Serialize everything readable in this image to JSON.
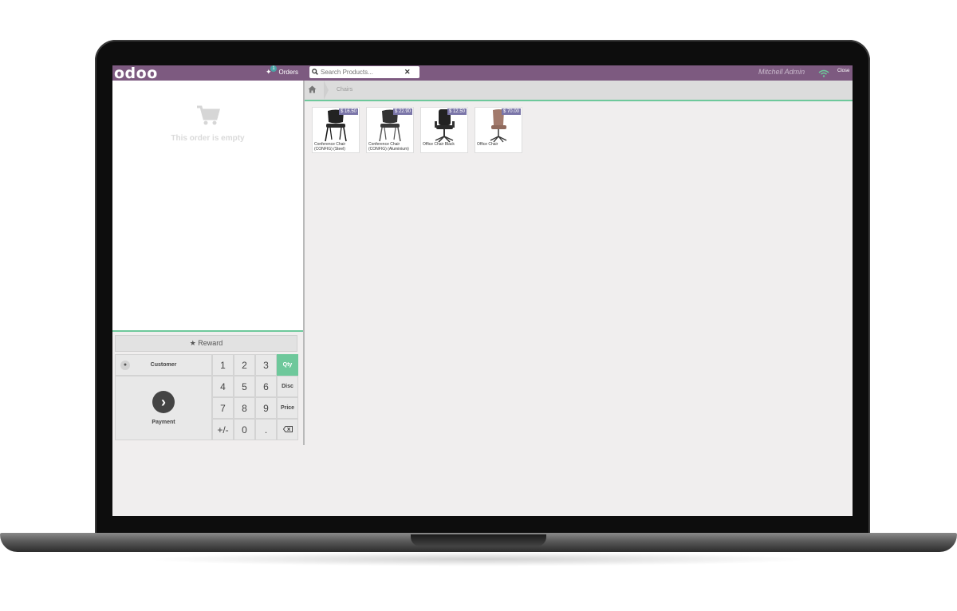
{
  "header": {
    "logo": "odoo",
    "orders_label": "Orders",
    "orders_count": "1",
    "search_placeholder": "Search Products...",
    "user": "Mitchell Admin",
    "close_label": "Close"
  },
  "order": {
    "empty_text": "This order is empty"
  },
  "controls": {
    "reward_label": "Reward",
    "customer_label": "Customer",
    "payment_label": "Payment",
    "keys": [
      "1",
      "2",
      "3",
      "4",
      "5",
      "6",
      "7",
      "8",
      "9",
      "+/-",
      "0",
      "."
    ],
    "modes": [
      "Qty",
      "Disc",
      "Price"
    ],
    "active_mode": "Qty"
  },
  "breadcrumb": {
    "category": "Chairs"
  },
  "products": [
    {
      "name": "Conference Chair (CONFIG) (Steel)",
      "price": "$ 16.50"
    },
    {
      "name": "Conference Chair (CONFIG) (Aluminium)",
      "price": "$ 22.90"
    },
    {
      "name": "Office Chair Black",
      "price": "$ 12.50"
    },
    {
      "name": "Office Chair",
      "price": "$ 70.00"
    }
  ],
  "colors": {
    "header": "#7d5a80",
    "accent": "#6ec89b",
    "price_tag": "#7a75a8"
  }
}
